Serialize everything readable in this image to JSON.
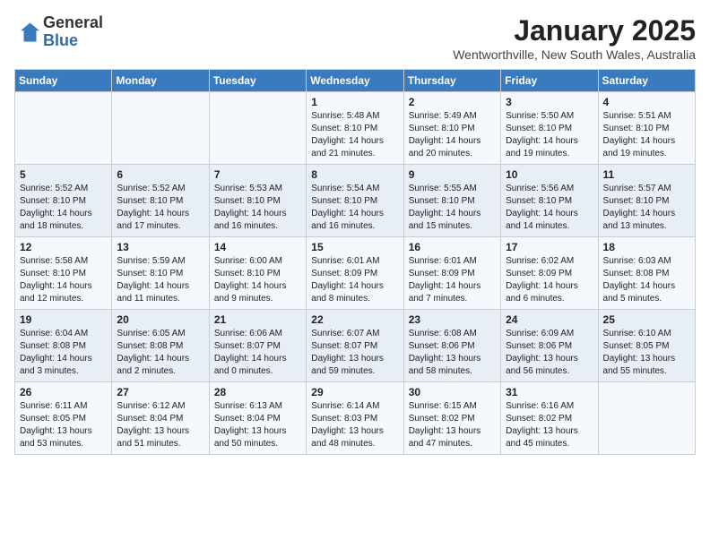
{
  "header": {
    "logo_general": "General",
    "logo_blue": "Blue",
    "month_title": "January 2025",
    "location": "Wentworthville, New South Wales, Australia"
  },
  "weekdays": [
    "Sunday",
    "Monday",
    "Tuesday",
    "Wednesday",
    "Thursday",
    "Friday",
    "Saturday"
  ],
  "weeks": [
    [
      {
        "day": "",
        "info": ""
      },
      {
        "day": "",
        "info": ""
      },
      {
        "day": "",
        "info": ""
      },
      {
        "day": "1",
        "info": "Sunrise: 5:48 AM\nSunset: 8:10 PM\nDaylight: 14 hours\nand 21 minutes."
      },
      {
        "day": "2",
        "info": "Sunrise: 5:49 AM\nSunset: 8:10 PM\nDaylight: 14 hours\nand 20 minutes."
      },
      {
        "day": "3",
        "info": "Sunrise: 5:50 AM\nSunset: 8:10 PM\nDaylight: 14 hours\nand 19 minutes."
      },
      {
        "day": "4",
        "info": "Sunrise: 5:51 AM\nSunset: 8:10 PM\nDaylight: 14 hours\nand 19 minutes."
      }
    ],
    [
      {
        "day": "5",
        "info": "Sunrise: 5:52 AM\nSunset: 8:10 PM\nDaylight: 14 hours\nand 18 minutes."
      },
      {
        "day": "6",
        "info": "Sunrise: 5:52 AM\nSunset: 8:10 PM\nDaylight: 14 hours\nand 17 minutes."
      },
      {
        "day": "7",
        "info": "Sunrise: 5:53 AM\nSunset: 8:10 PM\nDaylight: 14 hours\nand 16 minutes."
      },
      {
        "day": "8",
        "info": "Sunrise: 5:54 AM\nSunset: 8:10 PM\nDaylight: 14 hours\nand 16 minutes."
      },
      {
        "day": "9",
        "info": "Sunrise: 5:55 AM\nSunset: 8:10 PM\nDaylight: 14 hours\nand 15 minutes."
      },
      {
        "day": "10",
        "info": "Sunrise: 5:56 AM\nSunset: 8:10 PM\nDaylight: 14 hours\nand 14 minutes."
      },
      {
        "day": "11",
        "info": "Sunrise: 5:57 AM\nSunset: 8:10 PM\nDaylight: 14 hours\nand 13 minutes."
      }
    ],
    [
      {
        "day": "12",
        "info": "Sunrise: 5:58 AM\nSunset: 8:10 PM\nDaylight: 14 hours\nand 12 minutes."
      },
      {
        "day": "13",
        "info": "Sunrise: 5:59 AM\nSunset: 8:10 PM\nDaylight: 14 hours\nand 11 minutes."
      },
      {
        "day": "14",
        "info": "Sunrise: 6:00 AM\nSunset: 8:10 PM\nDaylight: 14 hours\nand 9 minutes."
      },
      {
        "day": "15",
        "info": "Sunrise: 6:01 AM\nSunset: 8:09 PM\nDaylight: 14 hours\nand 8 minutes."
      },
      {
        "day": "16",
        "info": "Sunrise: 6:01 AM\nSunset: 8:09 PM\nDaylight: 14 hours\nand 7 minutes."
      },
      {
        "day": "17",
        "info": "Sunrise: 6:02 AM\nSunset: 8:09 PM\nDaylight: 14 hours\nand 6 minutes."
      },
      {
        "day": "18",
        "info": "Sunrise: 6:03 AM\nSunset: 8:08 PM\nDaylight: 14 hours\nand 5 minutes."
      }
    ],
    [
      {
        "day": "19",
        "info": "Sunrise: 6:04 AM\nSunset: 8:08 PM\nDaylight: 14 hours\nand 3 minutes."
      },
      {
        "day": "20",
        "info": "Sunrise: 6:05 AM\nSunset: 8:08 PM\nDaylight: 14 hours\nand 2 minutes."
      },
      {
        "day": "21",
        "info": "Sunrise: 6:06 AM\nSunset: 8:07 PM\nDaylight: 14 hours\nand 0 minutes."
      },
      {
        "day": "22",
        "info": "Sunrise: 6:07 AM\nSunset: 8:07 PM\nDaylight: 13 hours\nand 59 minutes."
      },
      {
        "day": "23",
        "info": "Sunrise: 6:08 AM\nSunset: 8:06 PM\nDaylight: 13 hours\nand 58 minutes."
      },
      {
        "day": "24",
        "info": "Sunrise: 6:09 AM\nSunset: 8:06 PM\nDaylight: 13 hours\nand 56 minutes."
      },
      {
        "day": "25",
        "info": "Sunrise: 6:10 AM\nSunset: 8:05 PM\nDaylight: 13 hours\nand 55 minutes."
      }
    ],
    [
      {
        "day": "26",
        "info": "Sunrise: 6:11 AM\nSunset: 8:05 PM\nDaylight: 13 hours\nand 53 minutes."
      },
      {
        "day": "27",
        "info": "Sunrise: 6:12 AM\nSunset: 8:04 PM\nDaylight: 13 hours\nand 51 minutes."
      },
      {
        "day": "28",
        "info": "Sunrise: 6:13 AM\nSunset: 8:04 PM\nDaylight: 13 hours\nand 50 minutes."
      },
      {
        "day": "29",
        "info": "Sunrise: 6:14 AM\nSunset: 8:03 PM\nDaylight: 13 hours\nand 48 minutes."
      },
      {
        "day": "30",
        "info": "Sunrise: 6:15 AM\nSunset: 8:02 PM\nDaylight: 13 hours\nand 47 minutes."
      },
      {
        "day": "31",
        "info": "Sunrise: 6:16 AM\nSunset: 8:02 PM\nDaylight: 13 hours\nand 45 minutes."
      },
      {
        "day": "",
        "info": ""
      }
    ]
  ]
}
